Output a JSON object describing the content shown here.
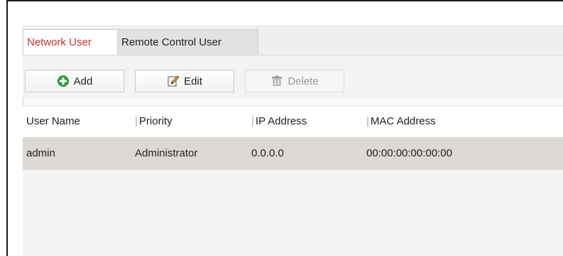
{
  "tabs": [
    {
      "label": "Network User",
      "active": true
    },
    {
      "label": "Remote Control User",
      "active": false
    }
  ],
  "toolbar": {
    "add_label": "Add",
    "edit_label": "Edit",
    "delete_label": "Delete",
    "add_icon": "plus-circle-icon",
    "edit_icon": "pencil-edit-icon",
    "delete_icon": "trash-icon"
  },
  "table": {
    "columns": [
      "User Name",
      "Priority",
      "IP Address",
      "MAC Address"
    ],
    "rows": [
      [
        "admin",
        "Administrator",
        "0.0.0.0",
        "00:00:00:00:00:00"
      ]
    ]
  },
  "colors": {
    "active_tab_text": "#cc3333",
    "selected_row": "#dcd8d4",
    "add_icon_green": "#2e9a3a"
  }
}
